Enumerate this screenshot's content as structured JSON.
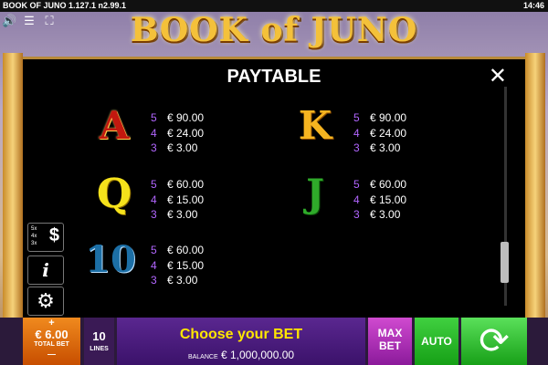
{
  "status": {
    "version": "BOOK OF JUNO  1.127.1 n2.99.1",
    "clock": "14:46"
  },
  "logo": {
    "text": "BOOK of JUNO"
  },
  "paytable": {
    "title": "PAYTABLE",
    "close_glyph": "✕",
    "symbols": [
      {
        "glyph": "A",
        "pays": [
          {
            "count": "5",
            "value": "€ 90.00"
          },
          {
            "count": "4",
            "value": "€ 24.00"
          },
          {
            "count": "3",
            "value": "€ 3.00"
          }
        ]
      },
      {
        "glyph": "K",
        "pays": [
          {
            "count": "5",
            "value": "€ 90.00"
          },
          {
            "count": "4",
            "value": "€ 24.00"
          },
          {
            "count": "3",
            "value": "€ 3.00"
          }
        ]
      },
      {
        "glyph": "Q",
        "pays": [
          {
            "count": "5",
            "value": "€ 60.00"
          },
          {
            "count": "4",
            "value": "€ 15.00"
          },
          {
            "count": "3",
            "value": "€ 3.00"
          }
        ]
      },
      {
        "glyph": "J",
        "pays": [
          {
            "count": "5",
            "value": "€ 60.00"
          },
          {
            "count": "4",
            "value": "€ 15.00"
          },
          {
            "count": "3",
            "value": "€ 3.00"
          }
        ]
      },
      {
        "glyph": "10",
        "pays": [
          {
            "count": "5",
            "value": "€ 60.00"
          },
          {
            "count": "4",
            "value": "€ 15.00"
          },
          {
            "count": "3",
            "value": "€ 3.00"
          }
        ]
      }
    ]
  },
  "side": {
    "paytable_small": [
      "5x",
      "4x",
      "3x"
    ],
    "dollar": "$",
    "info": "i",
    "gear": "⚙"
  },
  "bottom": {
    "plus": "+",
    "bet_value": "€ 6.00",
    "bet_label": "TOTAL BET",
    "minus": "—",
    "lines_value": "10",
    "lines_label": "LINES",
    "message": "Choose your BET",
    "balance_label": "BALANCE",
    "balance_value": "€ 1,000,000.00",
    "max_label": "MAX\nBET",
    "auto_label": "AUTO",
    "spin_glyph": "⟳"
  }
}
